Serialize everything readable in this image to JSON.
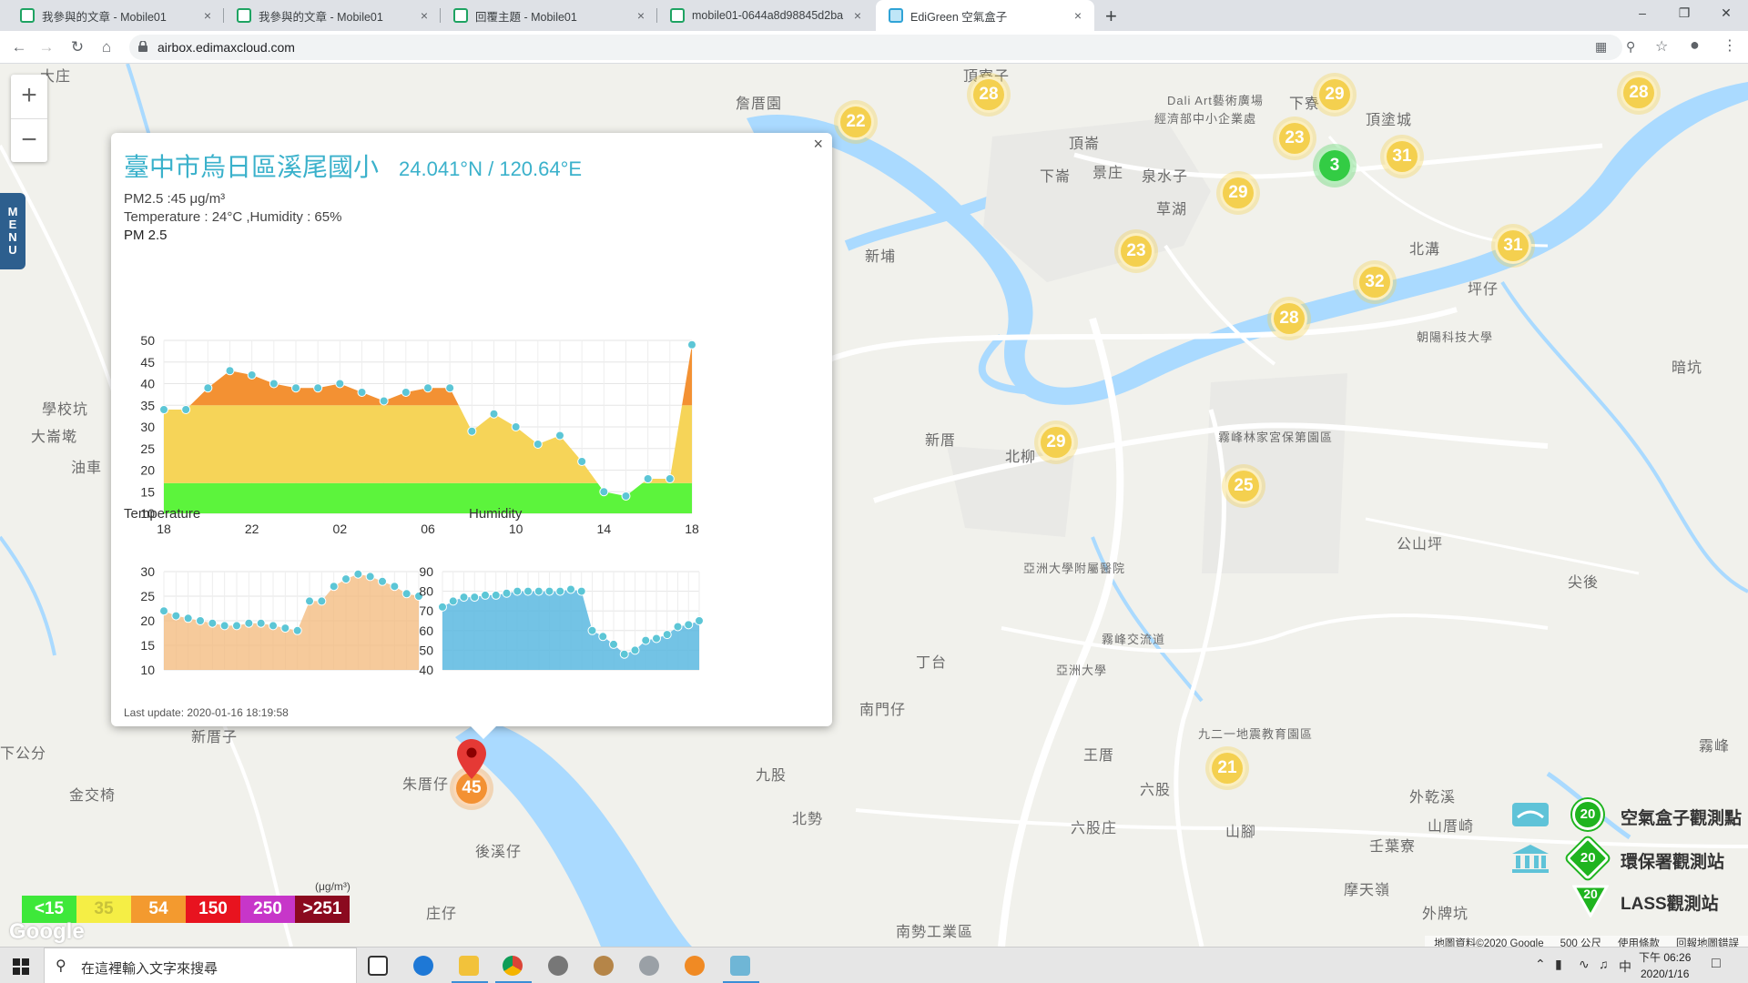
{
  "browser": {
    "tabs": [
      {
        "title": "我參與的文章 - Mobile01"
      },
      {
        "title": "我參與的文章 - Mobile01"
      },
      {
        "title": "回覆主題 - Mobile01"
      },
      {
        "title": "mobile01-0644a8d98845d2ba"
      },
      {
        "title": "EdiGreen 空氣盒子"
      }
    ],
    "close_glyph": "×",
    "new_tab": "+",
    "url": "airbox.edimaxcloud.com"
  },
  "map": {
    "zoom_in": "+",
    "zoom_out": "−",
    "menu_label": [
      "M",
      "E",
      "N",
      "U"
    ],
    "labels": [
      {
        "text": "大庄"
      },
      {
        "text": "詹厝園"
      },
      {
        "text": "頂寮子"
      },
      {
        "text": "下寮"
      },
      {
        "text": "頂塗城"
      },
      {
        "text": "Dali Art藝術廣場"
      },
      {
        "text": "經濟部中小企業處"
      },
      {
        "text": "頂崙"
      },
      {
        "text": "下崙"
      },
      {
        "text": "景庄"
      },
      {
        "text": "泉水子"
      },
      {
        "text": "草湖"
      },
      {
        "text": "新埔"
      },
      {
        "text": "北溝"
      },
      {
        "text": "坪仔"
      },
      {
        "text": "朝陽科技大學"
      },
      {
        "text": "暗坑"
      },
      {
        "text": "學校坑"
      },
      {
        "text": "大崙墘"
      },
      {
        "text": "油車"
      },
      {
        "text": "新厝"
      },
      {
        "text": "北柳"
      },
      {
        "text": "霧峰林家宮保第園區"
      },
      {
        "text": "公山坪"
      },
      {
        "text": "尖後"
      },
      {
        "text": "亞洲大學附屬醫院"
      },
      {
        "text": "丁台"
      },
      {
        "text": "亞洲大學"
      },
      {
        "text": "南門仔"
      },
      {
        "text": "霧峰交流道"
      },
      {
        "text": "九二一地震教育園區"
      },
      {
        "text": "王厝"
      },
      {
        "text": "霧峰"
      },
      {
        "text": "九股"
      },
      {
        "text": "北勢"
      },
      {
        "text": "六股"
      },
      {
        "text": "山腳"
      },
      {
        "text": "外乾溪"
      },
      {
        "text": "山厝崎"
      },
      {
        "text": "六股庄"
      },
      {
        "text": "壬葉寮"
      },
      {
        "text": "摩天嶺"
      },
      {
        "text": "外牌坑"
      },
      {
        "text": "新厝子"
      },
      {
        "text": "金交椅"
      },
      {
        "text": "朱厝仔"
      },
      {
        "text": "後溪仔"
      },
      {
        "text": "庄仔"
      },
      {
        "text": "南勢工業區"
      },
      {
        "text": "下公分"
      }
    ],
    "bubbles": [
      {
        "value": "28"
      },
      {
        "value": "22"
      },
      {
        "value": "29"
      },
      {
        "value": "28"
      },
      {
        "value": "23"
      },
      {
        "value": "3",
        "color": "green"
      },
      {
        "value": "31"
      },
      {
        "value": "29"
      },
      {
        "value": "23"
      },
      {
        "value": "31"
      },
      {
        "value": "32"
      },
      {
        "value": "28"
      },
      {
        "value": "29"
      },
      {
        "value": "25"
      },
      {
        "value": "21"
      },
      {
        "value": "45",
        "color": "orange"
      }
    ]
  },
  "popup": {
    "close": "×",
    "title": "臺中市烏日區溪尾國小",
    "coords": "24.041°N / 120.64°E",
    "pm_line": "PM2.5 :45 μg/m³",
    "temp_line": "Temperature : 24°C ,Humidity : 65%",
    "pm_chart_title": "PM 2.5",
    "temp_chart_title": "Temperature",
    "hum_chart_title": "Humidity",
    "last_update": "Last update: 2020-01-16 18:19:58"
  },
  "chart_data": [
    {
      "type": "area",
      "title": "PM 2.5",
      "x_tick_labels": [
        "18",
        "22",
        "02",
        "06",
        "10",
        "14",
        "18"
      ],
      "ylim": [
        10,
        50
      ],
      "y_ticks": [
        10,
        15,
        20,
        25,
        30,
        35,
        40,
        45,
        50
      ],
      "bands": [
        {
          "from": 10,
          "to": 17,
          "color": "#5cf43c"
        },
        {
          "from": 17,
          "to": 35,
          "color": "#f6d458"
        },
        {
          "from": 35,
          "to": 55,
          "color": "#f39133"
        }
      ],
      "values": [
        34,
        34,
        39,
        43,
        42,
        40,
        39,
        39,
        40,
        38,
        36,
        38,
        39,
        39,
        29,
        33,
        30,
        26,
        28,
        22,
        15,
        14,
        18,
        18,
        49
      ]
    },
    {
      "type": "area",
      "title": "Temperature",
      "ylim": [
        10,
        30
      ],
      "y_ticks": [
        10,
        15,
        20,
        25,
        30
      ],
      "color": "#f3b87a",
      "values": [
        22,
        21,
        20.5,
        20,
        19.5,
        19,
        19,
        19.5,
        19.5,
        19,
        18.5,
        18,
        24,
        24,
        27,
        28.5,
        29.5,
        29,
        28,
        27,
        25.5,
        25
      ]
    },
    {
      "type": "area",
      "title": "Humidity",
      "ylim": [
        40,
        90
      ],
      "y_ticks": [
        40,
        50,
        60,
        70,
        80,
        90
      ],
      "color": "#5ab8e0",
      "values": [
        72,
        75,
        77,
        77,
        78,
        78,
        79,
        80,
        80,
        80,
        80,
        80,
        81,
        80,
        60,
        57,
        53,
        48,
        50,
        55,
        56,
        58,
        62,
        63,
        65
      ]
    }
  ],
  "legend": {
    "unit": "(μg/m³)",
    "levels": [
      {
        "label": "<15",
        "color": "#3ee83a"
      },
      {
        "label": "35",
        "color": "#f5ee45"
      },
      {
        "label": "54",
        "color": "#f39a2f"
      },
      {
        "label": "150",
        "color": "#e8131f"
      },
      {
        "label": "250",
        "color": "#c736c9"
      },
      {
        "label": ">251",
        "color": "#8b0a1f"
      }
    ],
    "stations": [
      {
        "badge": "20",
        "name": "空氣盒子觀測點"
      },
      {
        "badge": "20",
        "name": "環保署觀測站"
      },
      {
        "badge": "20",
        "name": "LASS觀測站"
      }
    ],
    "google": "Google"
  },
  "attribution": {
    "mapdata": "地圖資料©2020 Google",
    "scale": "500 公尺",
    "terms": "使用條款",
    "report": "回報地圖錯誤"
  },
  "taskbar": {
    "search_placeholder": "在這裡輸入文字來搜尋",
    "time": "下午 06:26",
    "date": "2020/1/16",
    "ime": "中"
  }
}
